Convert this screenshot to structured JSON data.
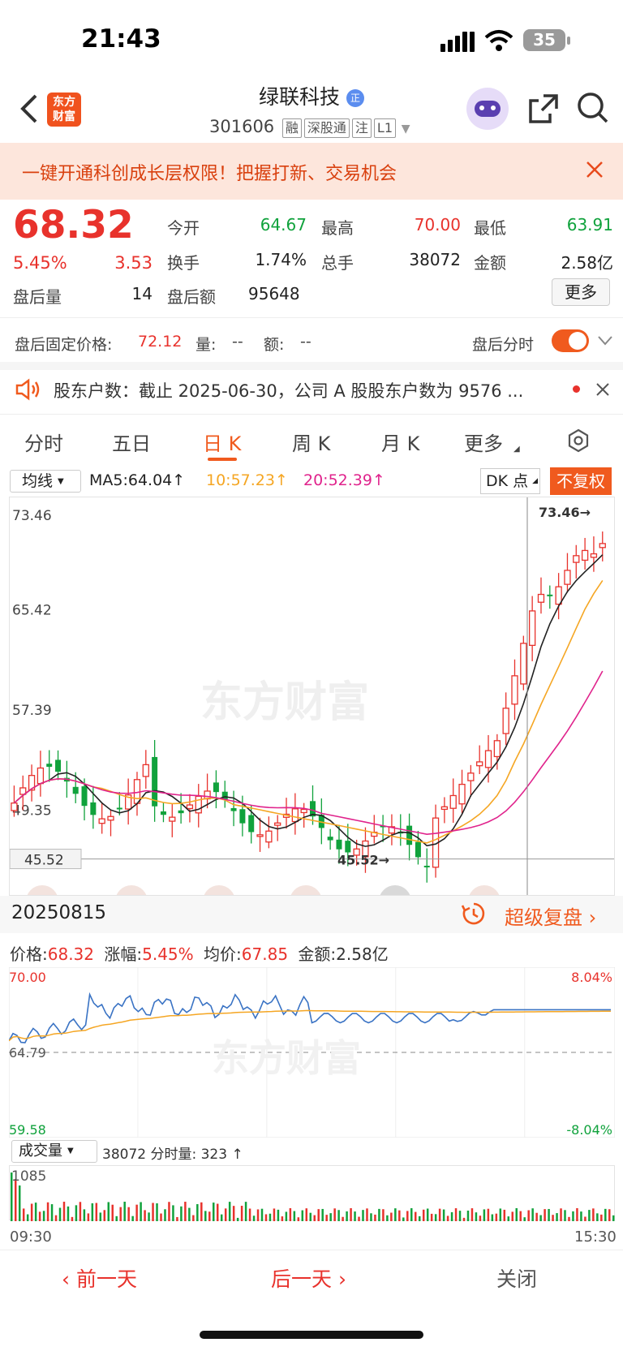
{
  "status_bar": {
    "time": "21:43",
    "battery": "35"
  },
  "header": {
    "logo_text": "东方财富",
    "stock_name": "绿联科技",
    "stock_code": "301606",
    "badges": [
      "融",
      "深股通",
      "注",
      "L1"
    ]
  },
  "banner": {
    "text": "一键开通科创成长层权限！把握打新、交易机会"
  },
  "quote": {
    "price": "68.32",
    "change_pct": "5.45%",
    "change": "3.53",
    "open_label": "今开",
    "open": "64.67",
    "high_label": "最高",
    "high": "70.00",
    "low_label": "最低",
    "low": "63.91",
    "turnover_label": "换手",
    "turnover": "1.74%",
    "volume_label": "总手",
    "volume": "38072",
    "amount_label": "金额",
    "amount": "2.58亿",
    "after_vol_label": "盘后量",
    "after_vol": "14",
    "after_amt_label": "盘后额",
    "after_amt": "95648",
    "more": "更多"
  },
  "after_hours": {
    "fixed_price_label": "盘后固定价格:",
    "fixed_price": "72.12",
    "vol_label": "量:",
    "vol": "--",
    "amt_label": "额:",
    "amt": "--",
    "timeshare_label": "盘后分时"
  },
  "news": {
    "text": "股东户数：截止 2025-06-30，公司 A 股股东户数为 9576 ..."
  },
  "tabs": [
    "分时",
    "五日",
    "日 K",
    "周 K",
    "月 K",
    "更多"
  ],
  "active_tab": "日 K",
  "kline": {
    "selector": "均线",
    "ma5": "MA5:64.04",
    "ma10": "10:57.23",
    "ma20": "20:52.39",
    "dk": "DK 点",
    "fuquan": "不复权",
    "y_labels": [
      "73.46",
      "65.42",
      "57.39",
      "49.35"
    ],
    "max_marker": "73.46→",
    "min_label": "45.52",
    "min_marker": "45.52→",
    "watermark": "东方财富",
    "colors": {
      "up": "#e8322c",
      "down": "#10a23c",
      "ma5": "#222222",
      "ma10": "#f5a623",
      "ma20": "#e0238c"
    }
  },
  "intraday": {
    "date": "20250815",
    "super_review": "超级复盘",
    "price_label": "价格:",
    "price": "68.32",
    "pct_label": "涨幅:",
    "pct": "5.45%",
    "avg_label": "均价:",
    "avg": "67.85",
    "amt_label": "金额:",
    "amt": "2.58亿",
    "y_top": "70.00",
    "y_mid": "64.79",
    "y_bot": "59.58",
    "pct_top": "8.04%",
    "pct_bot": "-8.04%",
    "vol_selector": "成交量",
    "vol_info": "38072 分时量: 323 ↑",
    "vol_max": "1085",
    "t_start": "09:30",
    "t_end": "15:30",
    "watermark": "东方财富"
  },
  "bottom": {
    "prev": "前一天",
    "next": "后一天",
    "close": "关闭"
  }
}
